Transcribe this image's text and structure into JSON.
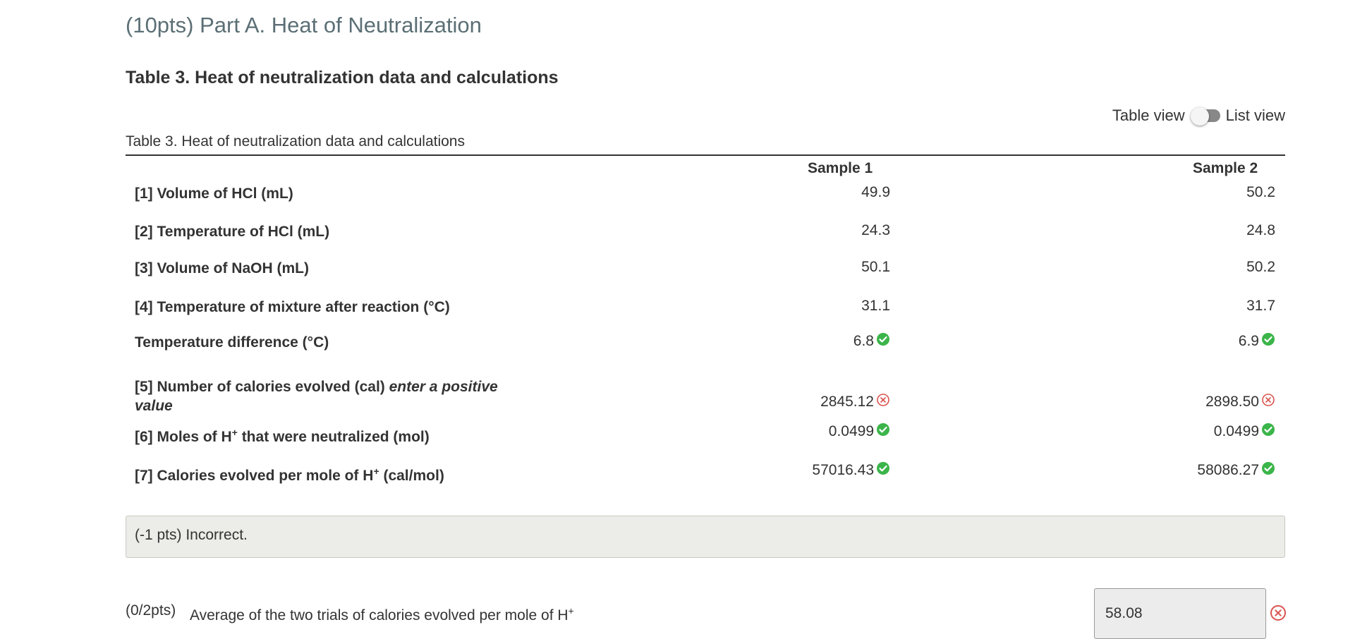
{
  "section": {
    "title": "(10pts) Part A. Heat of Neutralization"
  },
  "table_heading": "Table 3. Heat of neutralization data and calculations",
  "view_toggle": {
    "left_label": "Table view",
    "right_label": "List view"
  },
  "table": {
    "caption": "Table 3. Heat of neutralization data and calculations",
    "columns": [
      "Sample 1",
      "Sample 2"
    ],
    "rows": [
      {
        "label": "[1] Volume of HCl (mL)",
        "values": [
          "49.9",
          "50.2"
        ],
        "status": [
          "",
          ""
        ]
      },
      {
        "label": "[2] Temperature of HCl (mL)",
        "values": [
          "24.3",
          "24.8"
        ],
        "status": [
          "",
          ""
        ]
      },
      {
        "label": "[3] Volume of NaOH (mL)",
        "values": [
          "50.1",
          "50.2"
        ],
        "status": [
          "",
          ""
        ]
      },
      {
        "label": "[4] Temperature of mixture after reaction (°C)",
        "values": [
          "31.1",
          "31.7"
        ],
        "status": [
          "",
          ""
        ]
      },
      {
        "label": "Temperature difference (°C)",
        "values": [
          "6.8",
          "6.9"
        ],
        "status": [
          "correct",
          "correct"
        ]
      },
      {
        "label_main": "[5] Number of calories evolved (cal)",
        "label_italic": "enter a positive value",
        "values": [
          "2845.12",
          "2898.50"
        ],
        "status": [
          "incorrect",
          "incorrect"
        ]
      },
      {
        "label_pre": "[6] Moles of H",
        "label_sup": "+",
        "label_post": " that were neutralized (mol)",
        "values": [
          "0.0499",
          "0.0499"
        ],
        "status": [
          "correct",
          "correct"
        ]
      },
      {
        "label_pre": "[7] Calories evolved per mole of H",
        "label_sup": "+",
        "label_post": " (cal/mol)",
        "values": [
          "57016.43",
          "58086.27"
        ],
        "status": [
          "correct",
          "correct"
        ]
      }
    ]
  },
  "feedback": {
    "text": "(-1 pts) Incorrect."
  },
  "average": {
    "points": "(0/2pts)",
    "label_pre": "Average of the two trials of calories evolved per mole of H",
    "label_sup": "+",
    "value": "58.08",
    "status": "incorrect"
  },
  "colors": {
    "correct": "#3bb54a",
    "incorrect": "#d9534f",
    "title": "#5b6f75"
  }
}
